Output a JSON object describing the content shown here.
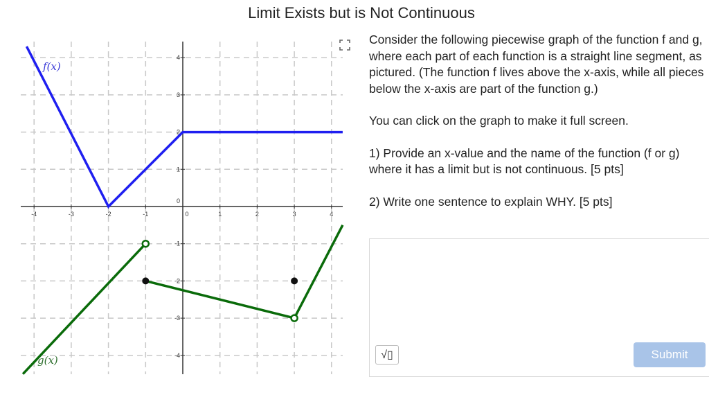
{
  "page": {
    "title": "Limit Exists but is Not Continuous"
  },
  "graph": {
    "f_label": "f(x)",
    "g_label": "g(x)",
    "x_tick_labels": [
      "-4",
      "-3",
      "-2",
      "-1",
      "0",
      "1",
      "2",
      "3",
      "4"
    ],
    "y_tick_labels": [
      "4",
      "3",
      "2",
      "1",
      "0",
      "-1",
      "-2",
      "-3",
      "-4"
    ],
    "colors": {
      "f": "#1f1ff0",
      "g": "#0a6b0a",
      "grid": "#c8c8c8",
      "axis": "#333333"
    },
    "f_points": [
      [
        -4.2,
        4.3
      ],
      [
        -2,
        0
      ],
      [
        0,
        2
      ],
      [
        4.3,
        2
      ]
    ],
    "g_segment_1": [
      [
        -4.3,
        -4.5
      ],
      [
        -1,
        -1
      ]
    ],
    "g_segment_2": [
      [
        -1,
        -2
      ],
      [
        3,
        -3
      ]
    ],
    "g_segment_3": [
      [
        3,
        -3
      ],
      [
        4.3,
        -0.5
      ]
    ],
    "g_open_points": [
      [
        -1,
        -1
      ],
      [
        3,
        -3
      ]
    ],
    "g_closed_points": [
      [
        -1,
        -2
      ],
      [
        3,
        -2
      ]
    ],
    "fullscreen_icon": "expand-arrows-icon"
  },
  "question": {
    "intro": "Consider the following piecewise graph of the function f and g, where each part of each function is a straight line segment, as pictured. (The function f lives above the x-axis, while all pieces below the x-axis are part of the function g.)",
    "click_note": "You can click on the graph to make it full screen.",
    "part1": "1) Provide an x-value and the name of the function (f or g) where it has a limit but is not continuous. [5 pts]",
    "part2": "2) Write one sentence to explain WHY. [5 pts]"
  },
  "answer": {
    "value": "",
    "math_button_icon": "square-root-icon",
    "math_button_glyph": "√▯",
    "submit_label": "Submit"
  }
}
